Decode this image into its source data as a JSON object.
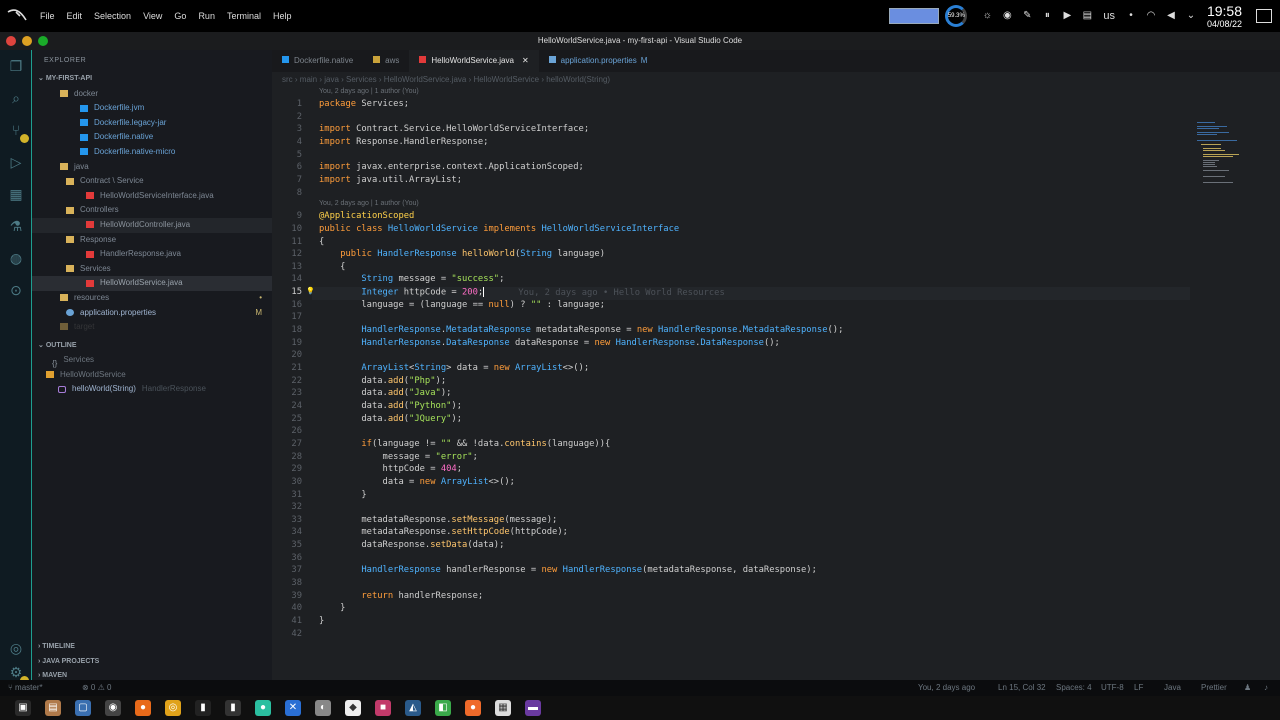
{
  "sys": {
    "menu": [
      "File",
      "Edit",
      "Selection",
      "View",
      "Go",
      "Run",
      "Terminal",
      "Help"
    ],
    "cpu": "59.3%",
    "lang": "us",
    "time": "19:58",
    "date": "04/08/22"
  },
  "window": {
    "title": "HelloWorldService.java - my-first-api - Visual Studio Code"
  },
  "sidebar": {
    "explorer": "EXPLORER",
    "project": "MY-FIRST-API",
    "outline": "OUTLINE",
    "timeline": "TIMELINE",
    "java_projects": "JAVA PROJECTS",
    "maven": "MAVEN",
    "tree": [
      {
        "label": "docker",
        "indent": 28,
        "kind": "folder",
        "color": "#7e8894"
      },
      {
        "label": "Dockerfile.jvm",
        "indent": 48,
        "kind": "docker",
        "color": "#6aa3d6"
      },
      {
        "label": "Dockerfile.legacy-jar",
        "indent": 48,
        "kind": "docker",
        "color": "#6aa3d6"
      },
      {
        "label": "Dockerfile.native",
        "indent": 48,
        "kind": "docker",
        "color": "#6aa3d6"
      },
      {
        "label": "Dockerfile.native-micro",
        "indent": 48,
        "kind": "docker",
        "color": "#6aa3d6"
      },
      {
        "label": "java",
        "indent": 28,
        "kind": "folder",
        "color": "#7e8894"
      },
      {
        "label": "Contract \\ Service",
        "indent": 34,
        "kind": "folder",
        "color": "#7e8894"
      },
      {
        "label": "HelloWorldServiceInterface.java",
        "indent": 54,
        "kind": "java",
        "color": "#7e8894"
      },
      {
        "label": "Controllers",
        "indent": 34,
        "kind": "folder",
        "color": "#7e8894"
      },
      {
        "label": "HelloWorldController.java",
        "indent": 54,
        "kind": "java",
        "color": "#8a929b",
        "hover": true
      },
      {
        "label": "Response",
        "indent": 34,
        "kind": "folder",
        "color": "#7e8894"
      },
      {
        "label": "HandlerResponse.java",
        "indent": 54,
        "kind": "java",
        "color": "#7e8894"
      },
      {
        "label": "Services",
        "indent": 34,
        "kind": "folder",
        "color": "#7e8894"
      },
      {
        "label": "HelloWorldService.java",
        "indent": 54,
        "kind": "java",
        "color": "#9aa3ac",
        "selected": true
      },
      {
        "label": "resources",
        "indent": 28,
        "kind": "folder",
        "color": "#7e8894",
        "right": "•"
      },
      {
        "label": "application.properties",
        "indent": 34,
        "kind": "gear",
        "color": "#9fb4d0",
        "right": "M"
      },
      {
        "label": "target",
        "indent": 28,
        "kind": "folder",
        "color": "#555",
        "dim": true
      }
    ],
    "outline_items": [
      {
        "label": "Services",
        "indent": 20,
        "kind": "brace",
        "color": "#6e7780"
      },
      {
        "label": "HelloWorldService",
        "indent": 14,
        "kind": "class",
        "color": "#6e7780"
      },
      {
        "label": "helloWorld(String)",
        "indent": 26,
        "kind": "method",
        "color": "#9fb4d0",
        "extra": "HandlerResponse"
      }
    ]
  },
  "tabs": [
    {
      "label": "Dockerfile.native",
      "icon": "docker",
      "active": false
    },
    {
      "label": "aws",
      "icon": "hash",
      "active": false
    },
    {
      "label": "HelloWorldService.java",
      "icon": "java",
      "active": true
    },
    {
      "label": "application.properties",
      "icon": "gear",
      "active": false,
      "mod": "M"
    }
  ],
  "breadcrumb": "src › main › java › Services › HelloWorldService.java › HelloWorldService › helloWorld(String)",
  "blame": {
    "top": "You, 2 days ago | 1 author (You)",
    "class": "You, 2 days ago | 1 author (You)",
    "inline": "You, 2 days ago • Hello World Resources"
  },
  "code_lines": [
    "[kw]package[/] Services;",
    "",
    "[kw]import[/] Contract.Service.HelloWorldServiceInterface;",
    "[kw]import[/] Response.HandlerResponse;",
    "",
    "[kw]import[/] javax.enterprise.context.ApplicationScoped;",
    "[kw]import[/] java.util.ArrayList;",
    "",
    "[an]@ApplicationScoped[/]",
    "[kw]public class[/] [ty]HelloWorldService[/] [kw]implements[/] [ty]HelloWorldServiceInterface[/]",
    "{",
    "    [kw]public[/] [ty]HandlerResponse[/] [fn]helloWorld[/]([ty]String[/] language)",
    "    {",
    "        [ty]String[/] message = [st]\"success\"[/];",
    "        [ty]Integer[/] httpCode = [nm]200[/];",
    "        language = (language == [kw]null[/]) ? [st]\"\"[/] : language;",
    "",
    "        [ty]HandlerResponse[/].[ty]MetadataResponse[/] metadataResponse = [kw]new[/] [ty]HandlerResponse[/].[ty]MetadataResponse[/]();",
    "        [ty]HandlerResponse[/].[ty]DataResponse[/] dataResponse = [kw]new[/] [ty]HandlerResponse[/].[ty]DataResponse[/]();",
    "",
    "        [ty]ArrayList[/]<[ty]String[/]> data = [kw]new[/] [ty]ArrayList[/]<>();",
    "        data.[fn]add[/]([st]\"Php\"[/]);",
    "        data.[fn]add[/]([st]\"Java\"[/]);",
    "        data.[fn]add[/]([st]\"Python\"[/]);",
    "        data.[fn]add[/]([st]\"JQuery\"[/]);",
    "",
    "        [kw]if[/](language != [st]\"\"[/] && !data.[fn]contains[/](language)){",
    "            message = [st]\"error\"[/];",
    "            httpCode = [nm]404[/];",
    "            data = [kw]new[/] [ty]ArrayList[/]<>();",
    "        }",
    "",
    "        metadataResponse.[fn]setMessage[/](message);",
    "        metadataResponse.[fn]setHttpCode[/](httpCode);",
    "        dataResponse.[fn]setData[/](data);",
    "",
    "        [ty]HandlerResponse[/] handlerResponse = [kw]new[/] [ty]HandlerResponse[/](metadataResponse, dataResponse);",
    "",
    "        [kw]return[/] handlerResponse;",
    "    }",
    "}",
    ""
  ],
  "status": {
    "branch": "master*",
    "problems": "⊗ 0 ⚠ 0",
    "blame": "You, 2 days ago",
    "position": "Ln 15, Col 32",
    "spaces": "Spaces: 4",
    "encoding": "UTF-8",
    "eol": "LF",
    "language": "Java",
    "prettier": "Prettier"
  },
  "taskbar": [
    {
      "name": "terminal-app",
      "bg": "#2a2a2a",
      "g": "▣"
    },
    {
      "name": "archive-app",
      "bg": "#b07a4a",
      "g": "▤"
    },
    {
      "name": "files-app",
      "bg": "#3a6fb0",
      "g": "▢"
    },
    {
      "name": "whisker-app",
      "bg": "#444",
      "g": "◉"
    },
    {
      "name": "firefox-app",
      "bg": "#e86a1a",
      "g": "●"
    },
    {
      "name": "chrome-app",
      "bg": "#e0a21a",
      "g": "◎"
    },
    {
      "name": "term2-app",
      "bg": "#222",
      "g": "▮"
    },
    {
      "name": "term3-app",
      "bg": "#333",
      "g": "▮"
    },
    {
      "name": "slack-app",
      "bg": "#2bbfa0",
      "g": "●"
    },
    {
      "name": "vscode-app",
      "bg": "#2a6fd4",
      "g": "✕"
    },
    {
      "name": "gimp-app",
      "bg": "#888",
      "g": "◐"
    },
    {
      "name": "inkscape-app",
      "bg": "#eee",
      "g": "◆"
    },
    {
      "name": "jetbrains-app",
      "bg": "#c23a6a",
      "g": "■"
    },
    {
      "name": "wireshark-app",
      "bg": "#2a5a8a",
      "g": "◭"
    },
    {
      "name": "qt-app",
      "bg": "#3aaa4a",
      "g": "◧"
    },
    {
      "name": "postman-app",
      "bg": "#ef6a2a",
      "g": "●"
    },
    {
      "name": "doc-app",
      "bg": "#ddd",
      "g": "▦"
    },
    {
      "name": "sublime-app",
      "bg": "#6a3aa0",
      "g": "▬"
    }
  ]
}
